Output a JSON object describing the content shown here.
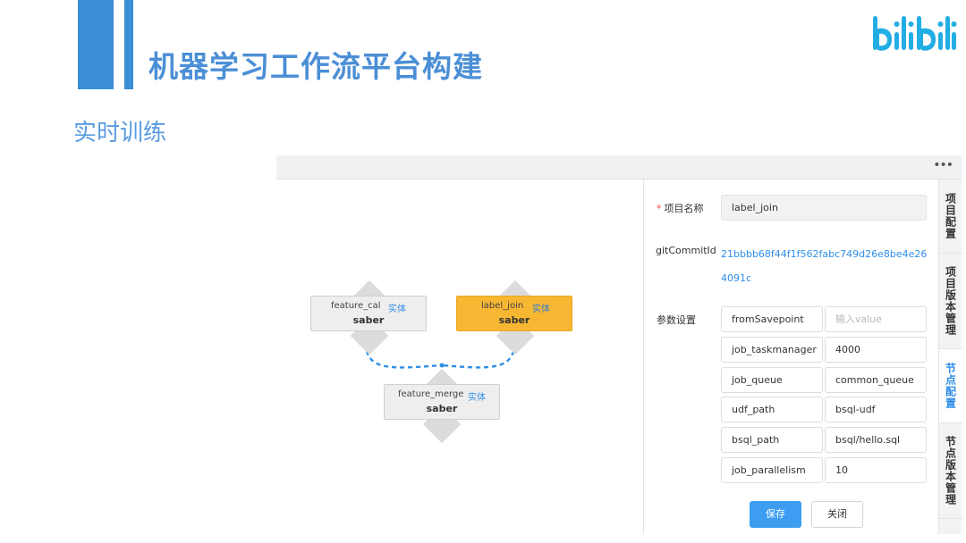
{
  "slide": {
    "title": "机器学习工作流平台构建",
    "subtitle": "实时训练",
    "logo_text": "bilibili"
  },
  "app": {
    "more_label": "•••",
    "nodes": [
      {
        "name": "feature_cal",
        "type": "实体",
        "sub": "saber",
        "selected": false
      },
      {
        "name": "label_join",
        "type": "实体",
        "sub": "saber",
        "selected": true
      },
      {
        "name": "feature_merge",
        "type": "实体",
        "sub": "saber",
        "selected": false
      }
    ],
    "panel": {
      "project_name_label": "项目名称",
      "project_name_required": "*",
      "project_name_value": "label_join",
      "commit_label": "gitCommitId",
      "commit_value": "21bbbb68f44f1f562fabc749d26e8be4e264091c",
      "params_label": "参数设置",
      "params": [
        {
          "key": "fromSavepoint",
          "value": "",
          "placeholder": "输入value"
        },
        {
          "key": "job_taskmanager",
          "value": "4000"
        },
        {
          "key": "job_queue",
          "value": "common_queue"
        },
        {
          "key": "udf_path",
          "value": "bsql-udf"
        },
        {
          "key": "bsql_path",
          "value": "bsql/hello.sql"
        },
        {
          "key": "job_parallelism",
          "value": "10"
        }
      ],
      "save_label": "保存",
      "close_label": "关闭"
    },
    "tabs": [
      {
        "label": "项目配置",
        "active": false
      },
      {
        "label": "项目版本管理",
        "active": false
      },
      {
        "label": "节点配置",
        "active": true
      },
      {
        "label": "节点版本管理",
        "active": false
      }
    ]
  },
  "colors": {
    "accent": "#3d9df1",
    "selected_node": "#f7b733",
    "title_blue": "#4b8fd6"
  }
}
